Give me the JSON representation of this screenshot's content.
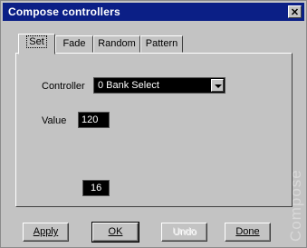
{
  "window": {
    "title": "Compose controllers",
    "close_symbol": "✕"
  },
  "tabs": [
    {
      "label": "Set"
    },
    {
      "label": "Fade"
    },
    {
      "label": "Random"
    },
    {
      "label": "Pattern"
    }
  ],
  "form": {
    "controller_label": "Controller",
    "controller_value": "0 Bank Select",
    "value_label": "Value",
    "value_value": "120",
    "extra_value": "16"
  },
  "buttons": {
    "apply": "Apply",
    "ok": "OK",
    "undo": "Undo",
    "done": "Done"
  },
  "watermark": "Compose",
  "colors": {
    "title_bg": "#0b1f86",
    "window_bg": "#c3c3c3",
    "field_bg": "#000000"
  }
}
